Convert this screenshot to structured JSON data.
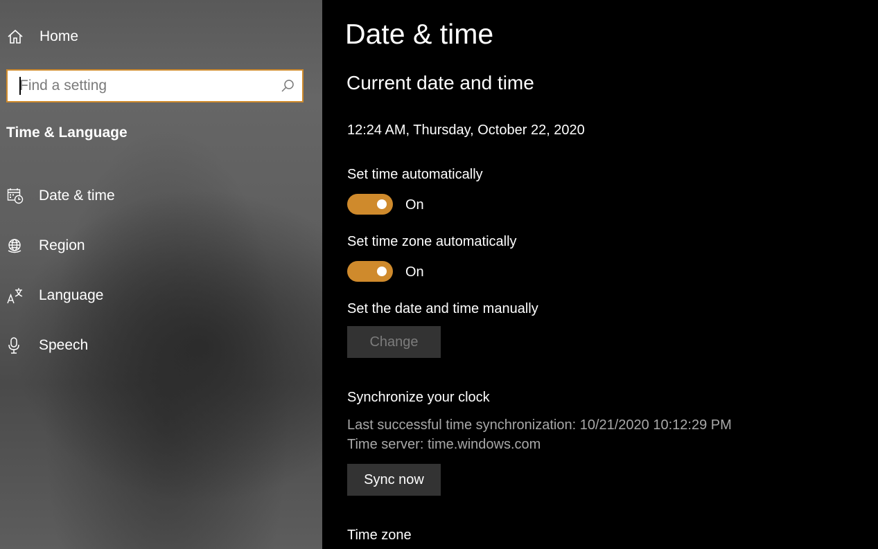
{
  "sidebar": {
    "home_label": "Home",
    "search": {
      "placeholder": "Find a setting"
    },
    "section_title": "Time & Language",
    "items": [
      {
        "label": "Date & time",
        "icon": "calendar-clock-icon"
      },
      {
        "label": "Region",
        "icon": "globe-icon"
      },
      {
        "label": "Language",
        "icon": "language-icon"
      },
      {
        "label": "Speech",
        "icon": "microphone-icon"
      }
    ]
  },
  "main": {
    "title": "Date & time",
    "current_heading": "Current date and time",
    "current_datetime": "12:24 AM, Thursday, October 22, 2020",
    "auto_time": {
      "label": "Set time automatically",
      "state": "On"
    },
    "auto_timezone": {
      "label": "Set time zone automatically",
      "state": "On"
    },
    "manual": {
      "label": "Set the date and time manually",
      "button": "Change"
    },
    "sync": {
      "heading": "Synchronize your clock",
      "last_sync": "Last successful time synchronization: 10/21/2020 10:12:29 PM",
      "server": "Time server: time.windows.com",
      "button": "Sync now"
    },
    "timezone_heading": "Time zone"
  },
  "colors": {
    "accent": "#cf8a2c",
    "button_bg": "#333333"
  }
}
